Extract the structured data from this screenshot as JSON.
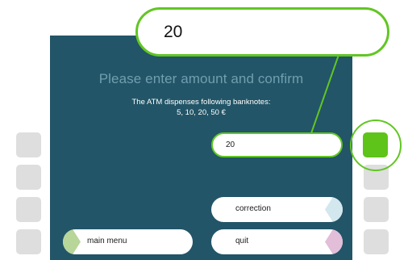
{
  "screen": {
    "prompt": "Please enter amount and confirm",
    "info_line1": "The ATM dispenses following banknotes:",
    "info_line2": "5, 10, 20, 50 €"
  },
  "amount_input": {
    "value": "20"
  },
  "zoom_callout": {
    "value": "20"
  },
  "buttons": {
    "correction": "correction",
    "main_menu": "main menu",
    "quit": "quit"
  },
  "colors": {
    "panel": "#225567",
    "highlight": "#62c623",
    "confirm_key": "#5ec419",
    "main_menu_accent": "#b8d59a",
    "correction_accent": "#d3e7ee",
    "quit_accent": "#e2bed9"
  }
}
